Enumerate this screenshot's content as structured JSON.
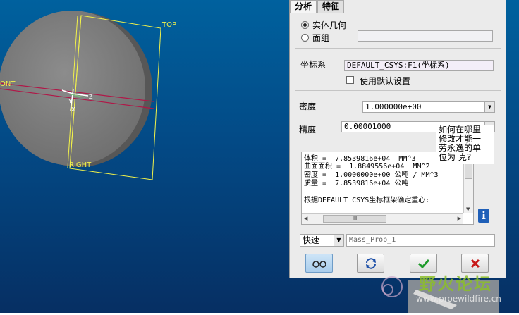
{
  "viewport": {
    "labels": {
      "top": "TOP",
      "front": "ONT",
      "right": "RIGHT"
    },
    "colors": {
      "bg_top": "#00619e",
      "bg_bottom": "#062f63",
      "plane": "#f2f24a",
      "axis": "#b01848"
    }
  },
  "panel": {
    "tabs": [
      {
        "label": "分析"
      },
      {
        "label": "特征"
      }
    ],
    "geometry": {
      "solid_label": "实体几何",
      "surface_label": "面组"
    },
    "csys": {
      "label": "坐标系",
      "value": "DEFAULT_CSYS:F1(坐标系)",
      "use_default_label": "使用默认设置"
    },
    "density": {
      "label": "密度",
      "value": "1.000000e+00"
    },
    "precision": {
      "label": "精度",
      "value": "0.00001000"
    },
    "results": {
      "lines": [
        "体积 =  7.8539816e+04  MM^3",
        "曲面面积 =  1.8849556e+04  MM^2",
        "密度 =  1.0000000e+00 公吨 / MM^3",
        "质量 =  7.8539816e+04 公吨",
        "",
        "根据DEFAULT_CSYS坐标框架确定重心:"
      ],
      "scroll_thumb_text": "III"
    },
    "bottom": {
      "mode_value": "快速",
      "name_value": "Mass_Prop_1"
    }
  },
  "tooltip": {
    "lines": [
      "如何在哪里",
      "修改才能一",
      "劳永逸的单",
      "位为   克?"
    ]
  },
  "watermark": {
    "text": "野火论坛",
    "url": "www.proewildfire.cn"
  }
}
